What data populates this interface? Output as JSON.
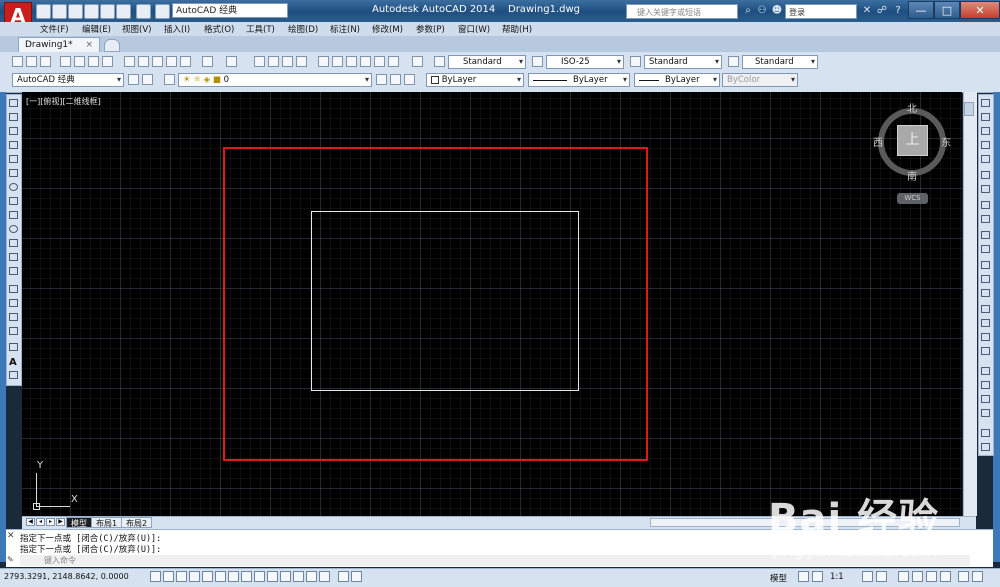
{
  "app": {
    "title": "Autodesk AutoCAD 2014",
    "document": "Drawing1.dwg",
    "logo_letter": "A",
    "workspace": "AutoCAD 经典",
    "search_placeholder": "键入关键字或短语",
    "signin": "登录"
  },
  "window_controls": {
    "minimize": "—",
    "maximize": "□",
    "close": "✕"
  },
  "menu": [
    "文件(F)",
    "编辑(E)",
    "视图(V)",
    "插入(I)",
    "格式(O)",
    "工具(T)",
    "绘图(D)",
    "标注(N)",
    "修改(M)",
    "参数(P)",
    "窗口(W)",
    "帮助(H)"
  ],
  "tabs": {
    "active": "Drawing1*",
    "close_glyph": "×"
  },
  "styles": {
    "text_style": "Standard",
    "dim_style": "ISO-25",
    "table_style": "Standard",
    "mleader_style": "Standard"
  },
  "layers": {
    "workspace": "AutoCAD 经典",
    "current_layer": "0",
    "color": "ByLayer",
    "linetype": "ByLayer",
    "lineweight": "ByLayer",
    "plotstyle": "ByColor"
  },
  "viewport": {
    "label": "[一][俯视][二维线框]",
    "viewcube": {
      "top": "上",
      "north": "北",
      "south": "南",
      "east": "东",
      "west": "西",
      "wcs": "WCS"
    },
    "ucs": {
      "x": "X",
      "y": "Y"
    },
    "outer_rect_color": "#e01818",
    "inner_rect_color": "#e8e8e8"
  },
  "layout_tabs": [
    "模型",
    "布局1",
    "布局2"
  ],
  "command": {
    "history": [
      "指定下一点或 [闭合(C)/放弃(U)]:",
      "指定下一点或 [闭合(C)/放弃(U)]:"
    ],
    "placeholder": "键入命令",
    "close_glyph": "✕",
    "tool_glyph": "✎"
  },
  "status": {
    "coordinates": "2793.3291, 2148.8642, 0.0000",
    "model": "模型",
    "annotation_scale": "1:1"
  },
  "watermark": {
    "logo": "Bai 经验",
    "url": "jingyan.baidu.com"
  }
}
